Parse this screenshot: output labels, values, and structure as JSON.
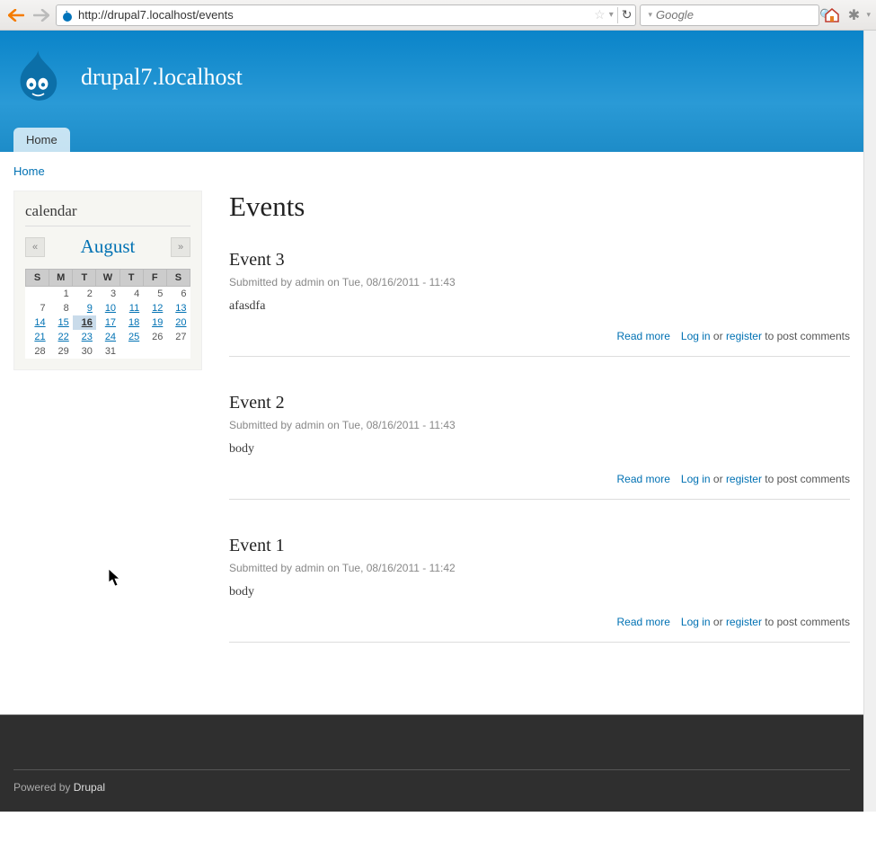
{
  "browser": {
    "url": "http://drupal7.localhost/events",
    "search_placeholder": "Google"
  },
  "site": {
    "name": "drupal7.localhost",
    "home_tab": "Home"
  },
  "breadcrumb": {
    "home": "Home"
  },
  "sidebar": {
    "calendar_title": "calendar",
    "month": "August",
    "prev": "«",
    "next": "»",
    "days": [
      "S",
      "M",
      "T",
      "W",
      "T",
      "F",
      "S"
    ],
    "weeks": [
      [
        {
          "n": ""
        },
        {
          "n": "1"
        },
        {
          "n": "2"
        },
        {
          "n": "3"
        },
        {
          "n": "4"
        },
        {
          "n": "5"
        },
        {
          "n": "6"
        }
      ],
      [
        {
          "n": "7"
        },
        {
          "n": "8"
        },
        {
          "n": "9",
          "l": true
        },
        {
          "n": "10",
          "l": true
        },
        {
          "n": "11",
          "l": true
        },
        {
          "n": "12",
          "l": true
        },
        {
          "n": "13",
          "l": true
        }
      ],
      [
        {
          "n": "14",
          "l": true
        },
        {
          "n": "15",
          "l": true
        },
        {
          "n": "16",
          "l": true,
          "t": true
        },
        {
          "n": "17",
          "l": true
        },
        {
          "n": "18",
          "l": true
        },
        {
          "n": "19",
          "l": true
        },
        {
          "n": "20",
          "l": true
        }
      ],
      [
        {
          "n": "21",
          "l": true
        },
        {
          "n": "22",
          "l": true
        },
        {
          "n": "23",
          "l": true
        },
        {
          "n": "24",
          "l": true
        },
        {
          "n": "25",
          "l": true
        },
        {
          "n": "26"
        },
        {
          "n": "27"
        }
      ],
      [
        {
          "n": "28"
        },
        {
          "n": "29"
        },
        {
          "n": "30"
        },
        {
          "n": "31"
        },
        {
          "n": ""
        },
        {
          "n": ""
        },
        {
          "n": ""
        }
      ]
    ]
  },
  "main": {
    "title": "Events",
    "read_more": "Read more",
    "login": "Log in",
    "or": " or ",
    "register": "register",
    "to_post": " to post comments",
    "submitted_prefix": "Submitted by ",
    "on": " on ",
    "nodes": [
      {
        "title": "Event 3",
        "author": "admin",
        "date": "Tue, 08/16/2011 - 11:43",
        "body": "afasdfa"
      },
      {
        "title": "Event 2",
        "author": "admin",
        "date": "Tue, 08/16/2011 - 11:43",
        "body": "body"
      },
      {
        "title": "Event 1",
        "author": "admin",
        "date": "Tue, 08/16/2011 - 11:42",
        "body": "body"
      }
    ]
  },
  "footer": {
    "powered": "Powered by ",
    "drupal": "Drupal"
  }
}
